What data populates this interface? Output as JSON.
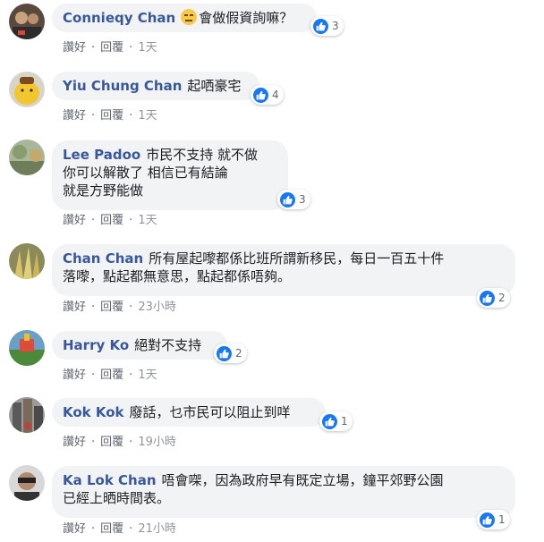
{
  "actions": {
    "like": "讚好",
    "reply": "回覆",
    "sep": "·"
  },
  "comments": [
    {
      "author": "Connieqy Chan",
      "text": "會做假資詢嘛？",
      "emoji": "expressionless-emoji",
      "likes": "3",
      "time": "1天"
    },
    {
      "author": "Yiu Chung Chan",
      "text": "起哂豪宅",
      "likes": "4",
      "time": "1天"
    },
    {
      "author": "Lee Padoo",
      "text_lines": [
        "市民不支持 就不做",
        "你可以解散了 相信已有結論",
        "就是方野能做"
      ],
      "likes": "3",
      "time": "1天"
    },
    {
      "author": "Chan Chan",
      "text_lines": [
        "所有屋起嚟都係比班所謂新移民，每日一百五十件",
        "落嚟，點起都無意思，點起都係唔夠。"
      ],
      "likes": "2",
      "time": "23小時"
    },
    {
      "author": "Harry Ko",
      "text": "絕對不支持",
      "likes": "2",
      "time": "1天"
    },
    {
      "author": "Kok Kok",
      "text": "廢話，乜市民可以阻止到咩",
      "likes": "1",
      "time": "19小時"
    },
    {
      "author": "Ka Lok Chan",
      "text_lines": [
        "唔會㗎，因為政府早有既定立場，鐘平郊野公園",
        "已經上晒時間表。"
      ],
      "likes": "1",
      "time": "21小時"
    }
  ],
  "colors": {
    "author": "#385898",
    "like_blue": "#1877f2",
    "bubble": "#f2f3f5"
  }
}
